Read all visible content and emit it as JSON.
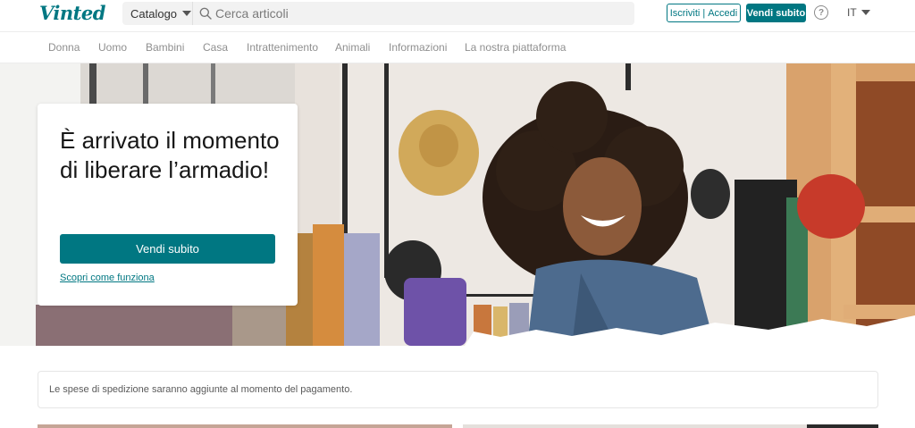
{
  "header": {
    "logo": "Vinted",
    "catalog_label": "Catalogo",
    "search_placeholder": "Cerca articoli",
    "signup_label": "Iscriviti",
    "login_label": "Accedi",
    "auth_separator": "|",
    "sell_label": "Vendi subito",
    "help_glyph": "?",
    "language": "IT"
  },
  "nav": {
    "categories": [
      "Donna",
      "Uomo",
      "Bambini",
      "Casa",
      "Intrattenimento",
      "Animali",
      "Informazioni",
      "La nostra piattaforma"
    ]
  },
  "hero": {
    "title": "È arrivato il momento di liberare l’armadio!",
    "cta_label": "Vendi subito",
    "link_label": "Scopri come funziona"
  },
  "notice": {
    "text": "Le spese di spedizione saranno aggiunte al momento del pagamento."
  },
  "colors": {
    "brand": "#007782",
    "text": "#171717",
    "muted": "#8f8f8f"
  },
  "icons": [
    "search-icon",
    "help-icon",
    "chevron-down-icon"
  ]
}
